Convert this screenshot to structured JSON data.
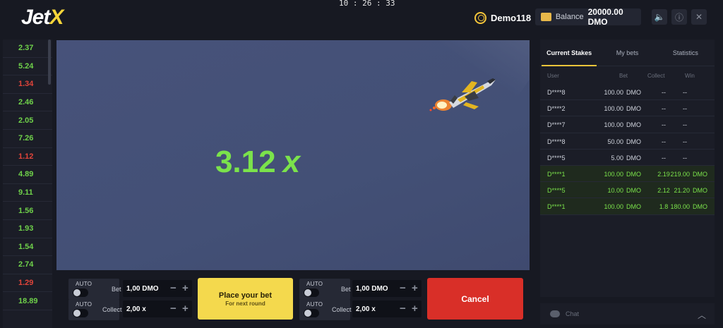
{
  "header": {
    "logo": {
      "text": "Jet",
      "accent": "X"
    },
    "clock": "10 : 26 : 33",
    "user": {
      "name": "Demo118",
      "icon": "user-icon"
    },
    "balance": {
      "label": "Balance",
      "value": "20000.00 DMO",
      "icon": "wallet-icon"
    },
    "buttons": [
      {
        "name": "sound-button",
        "icon": "speaker-icon",
        "glyph": "🔈"
      },
      {
        "name": "info-button",
        "icon": "info-icon",
        "glyph": "ⓘ"
      },
      {
        "name": "close-button",
        "icon": "close-icon",
        "glyph": "✕"
      }
    ]
  },
  "history": [
    {
      "value": "2.37",
      "tone": "g"
    },
    {
      "value": "5.24",
      "tone": "g"
    },
    {
      "value": "1.34",
      "tone": "r"
    },
    {
      "value": "2.46",
      "tone": "g"
    },
    {
      "value": "2.05",
      "tone": "g"
    },
    {
      "value": "7.26",
      "tone": "g"
    },
    {
      "value": "1.12",
      "tone": "r"
    },
    {
      "value": "4.89",
      "tone": "g"
    },
    {
      "value": "9.11",
      "tone": "g"
    },
    {
      "value": "1.56",
      "tone": "g"
    },
    {
      "value": "1.93",
      "tone": "g"
    },
    {
      "value": "1.54",
      "tone": "g"
    },
    {
      "value": "2.74",
      "tone": "g"
    },
    {
      "value": "1.29",
      "tone": "r"
    },
    {
      "value": "18.89",
      "tone": "g"
    }
  ],
  "game": {
    "multiplier": "3.12",
    "multiplier_suffix": "x",
    "jet_icon": "jet-icon"
  },
  "bet_panels": [
    {
      "auto_label": "AUTO",
      "bet_label": "Bet",
      "bet_value": "1,00 DMO",
      "collect_label": "Collect",
      "collect_value": "2,00 x"
    },
    {
      "auto_label": "AUTO",
      "bet_label": "Bet",
      "bet_value": "1,00 DMO",
      "collect_label": "Collect",
      "collect_value": "2,00 x"
    }
  ],
  "place_bet": {
    "title": "Place your bet",
    "subtitle": "For next round"
  },
  "cancel": {
    "label": "Cancel"
  },
  "stakes": {
    "tabs": [
      "Current Stakes",
      "My bets",
      "Statistics"
    ],
    "active_tab": 0,
    "columns": [
      "User",
      "Bet",
      "Collect",
      "Win"
    ],
    "rows": [
      {
        "user": "D****8",
        "bet": "100.00",
        "cur": "DMO",
        "collect": "--",
        "win": "--",
        "wcur": "",
        "won": false
      },
      {
        "user": "D****2",
        "bet": "100.00",
        "cur": "DMO",
        "collect": "--",
        "win": "--",
        "wcur": "",
        "won": false
      },
      {
        "user": "D****7",
        "bet": "100.00",
        "cur": "DMO",
        "collect": "--",
        "win": "--",
        "wcur": "",
        "won": false
      },
      {
        "user": "D****8",
        "bet": "50.00",
        "cur": "DMO",
        "collect": "--",
        "win": "--",
        "wcur": "",
        "won": false
      },
      {
        "user": "D****5",
        "bet": "5.00",
        "cur": "DMO",
        "collect": "--",
        "win": "--",
        "wcur": "",
        "won": false
      },
      {
        "user": "D****1",
        "bet": "100.00",
        "cur": "DMO",
        "collect": "2.19",
        "win": "219.00",
        "wcur": "DMO",
        "won": true
      },
      {
        "user": "D****5",
        "bet": "10.00",
        "cur": "DMO",
        "collect": "2.12",
        "win": "21.20",
        "wcur": "DMO",
        "won": true
      },
      {
        "user": "D****1",
        "bet": "100.00",
        "cur": "DMO",
        "collect": "1.8",
        "win": "180.00",
        "wcur": "DMO",
        "won": true
      }
    ]
  },
  "chat": {
    "label": "Chat",
    "icon": "chat-icon"
  },
  "colors": {
    "accent": "#f5c53a",
    "multiplier": "#7be34b",
    "win": "#6fd14a",
    "loss": "#e0443a",
    "place_bet": "#f4d94d",
    "cancel": "#d92f28"
  }
}
